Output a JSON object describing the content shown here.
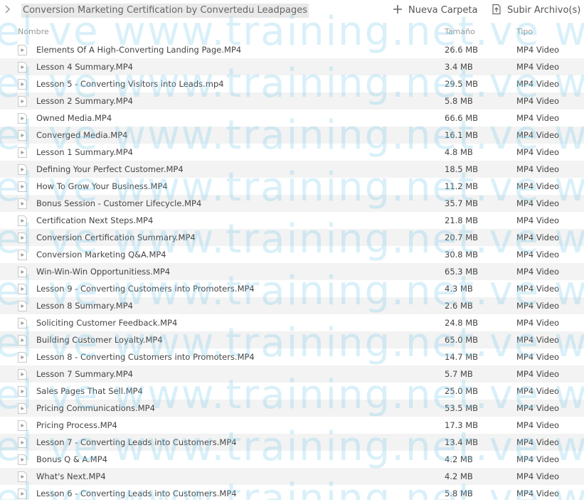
{
  "breadcrumb": {
    "current": "Conversion Marketing Certification by Convertedu Leadpages"
  },
  "actions": {
    "new_folder": "Nueva Carpeta",
    "upload": "Subir Archivo(s)"
  },
  "columns": {
    "name": "Nombre",
    "size": "Tamaño",
    "type": "Tipo"
  },
  "watermark": "el ve   www.training.net.ve   www.tr",
  "files": [
    {
      "name": "Elements Of A High-Converting Landing Page.MP4",
      "size": "26.6 MB",
      "type": "MP4 Video"
    },
    {
      "name": "Lesson 4 Summary.MP4",
      "size": "3.4 MB",
      "type": "MP4 Video"
    },
    {
      "name": "Lesson 5 - Converting Visitors into Leads.mp4",
      "size": "29.5 MB",
      "type": "MP4 Video"
    },
    {
      "name": "Lesson 2 Summary.MP4",
      "size": "5.8 MB",
      "type": "MP4 Video"
    },
    {
      "name": "Owned Media.MP4",
      "size": "66.6 MB",
      "type": "MP4 Video"
    },
    {
      "name": "Converged Media.MP4",
      "size": "16.1 MB",
      "type": "MP4 Video"
    },
    {
      "name": "Lesson 1 Summary.MP4",
      "size": "4.8 MB",
      "type": "MP4 Video"
    },
    {
      "name": "Defining Your Perfect Customer.MP4",
      "size": "18.5 MB",
      "type": "MP4 Video"
    },
    {
      "name": "How To Grow Your Business.MP4",
      "size": "11.2 MB",
      "type": "MP4 Video"
    },
    {
      "name": "Bonus Session - Customer Lifecycle.MP4",
      "size": "35.7 MB",
      "type": "MP4 Video"
    },
    {
      "name": "Certification Next Steps.MP4",
      "size": "21.8 MB",
      "type": "MP4 Video"
    },
    {
      "name": "Conversion Certification Summary.MP4",
      "size": "20.7 MB",
      "type": "MP4 Video"
    },
    {
      "name": "Conversion Marketing Q&A.MP4",
      "size": "30.8 MB",
      "type": "MP4 Video"
    },
    {
      "name": "Win-Win-Win Opportunitiess.MP4",
      "size": "65.3 MB",
      "type": "MP4 Video"
    },
    {
      "name": "Lesson 9 - Converting Customers into Promoters.MP4",
      "size": "4.3 MB",
      "type": "MP4 Video"
    },
    {
      "name": "Lesson 8 Summary.MP4",
      "size": "2.6 MB",
      "type": "MP4 Video"
    },
    {
      "name": "Soliciting Customer Feedback.MP4",
      "size": "24.8 MB",
      "type": "MP4 Video"
    },
    {
      "name": "Building Customer Loyalty.MP4",
      "size": "65.0 MB",
      "type": "MP4 Video"
    },
    {
      "name": "Lesson 8 - Converting Customers into Promoters.MP4",
      "size": "14.7 MB",
      "type": "MP4 Video"
    },
    {
      "name": "Lesson 7 Summary.MP4",
      "size": "5.7 MB",
      "type": "MP4 Video"
    },
    {
      "name": "Sales Pages That Sell.MP4",
      "size": "25.0 MB",
      "type": "MP4 Video"
    },
    {
      "name": "Pricing Communications.MP4",
      "size": "53.5 MB",
      "type": "MP4 Video"
    },
    {
      "name": "Pricing Process.MP4",
      "size": "17.3 MB",
      "type": "MP4 Video"
    },
    {
      "name": "Lesson 7 - Converting Leads into Customers.MP4",
      "size": "13.4 MB",
      "type": "MP4 Video"
    },
    {
      "name": "Bonus Q & A.MP4",
      "size": "4.2 MB",
      "type": "MP4 Video"
    },
    {
      "name": "What's Next.MP4",
      "size": "4.2 MB",
      "type": "MP4 Video"
    },
    {
      "name": "Lesson 6 - Converting Leads into Customers.MP4",
      "size": "5.8 MB",
      "type": "MP4 Video"
    }
  ]
}
